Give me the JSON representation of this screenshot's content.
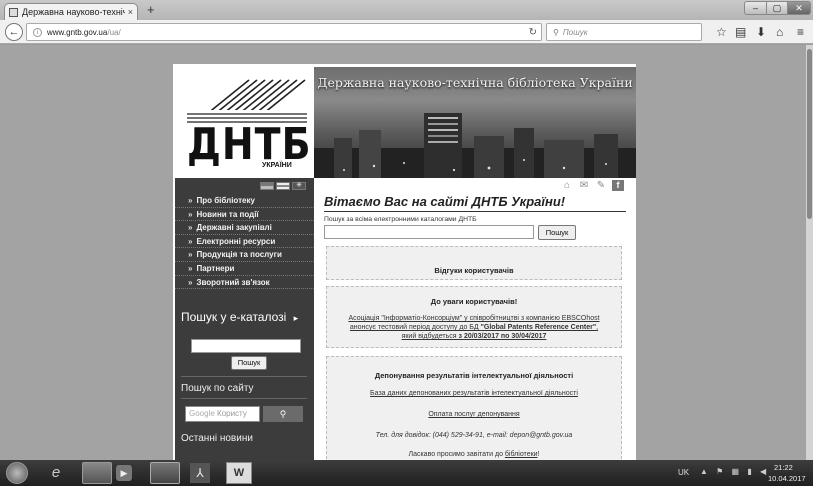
{
  "browser": {
    "tab_title": "Державна науково-технічна б...",
    "tab_close": "×",
    "new_tab": "+",
    "url_host": "www.gntb.gov.ua",
    "url_path": "/ua/",
    "search_placeholder": "Пошук",
    "window_controls": {
      "minimize": "–",
      "maximize": "▢",
      "close": "✕"
    }
  },
  "header": {
    "site_title": "Державна науково-технічна бібліотека України",
    "logo_text": "ДНТБ",
    "logo_sub": "УКРАЇНИ"
  },
  "sidebar": {
    "menu": [
      {
        "label": "Про бібліотеку"
      },
      {
        "label": "Новини та події"
      },
      {
        "label": "Державні закупівлі"
      },
      {
        "label": "Електронні ресурси"
      },
      {
        "label": "Продукція та послуги"
      },
      {
        "label": "Партнери"
      },
      {
        "label": "Зворотний зв'язок"
      }
    ],
    "menu_bullet": "»",
    "catalog_heading": "Пошук у е-каталозі",
    "catalog_arrow": "▸",
    "catalog_button": "Пошук",
    "site_search_heading": "Пошук по сайту",
    "site_search_google": "Google",
    "site_search_placeholder": "Користу",
    "site_search_icon": "search-icon",
    "latest_news": "Останні новини"
  },
  "content": {
    "welcome": "Вітаємо Вас на сайті ДНТБ України!",
    "search_label": "Пошук за всіма електронними каталогами ДНТБ",
    "search_button": "Пошук",
    "reviews": "Відгуки користувачів",
    "notice_title": "До уваги користувачів!",
    "notice_line1": "Асоціація \"Інформатіо-Консорціум\" у співробітництві з компанією EBSCOhost",
    "notice_line2_pre": "анонсує тестовий період доступу до БД ",
    "notice_line2_bold": "\"Global Patents Reference Center\"",
    "notice_line2_post": ",",
    "notice_line3_pre": "який відбудеться ",
    "notice_line3_bold": "з 20/03/2017 по 30/04/2017",
    "deposit_title": "Депонування результатів інтелектуальної діяльності",
    "deposit_link": "База даних депонованих результатів інтелектуальної діяльності",
    "deposit_payment": "Оплата послуг депонування",
    "deposit_contact": "Тел. для довідок: (044) 529-34-91, e-mail: depon@gntb.gov.ua",
    "welcome_pre": "Ласкаво просимо завітати до ",
    "welcome_link": "бібліотеки",
    "welcome_post": "!"
  },
  "taskbar": {
    "lang": "UK",
    "time": "21:22",
    "date": "10.04.2017"
  },
  "colors": {
    "sidebar_bg": "#3c3c3c",
    "box_bg": "#f0f0f0",
    "taskbar": "#2b2b2b"
  }
}
